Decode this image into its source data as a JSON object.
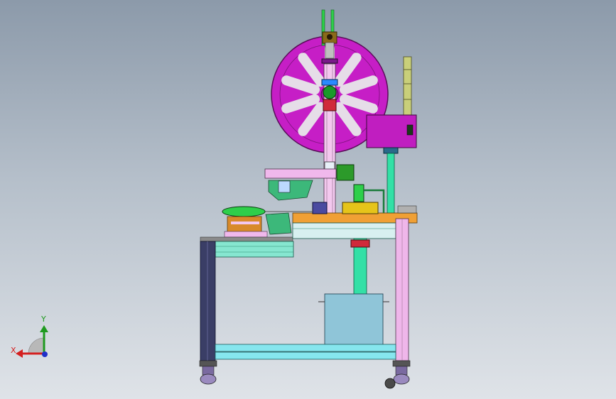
{
  "view": {
    "background_top": "#8c9aaa",
    "background_bottom": "#dfe3e8"
  },
  "triad": {
    "x_label": "X",
    "y_label": "Y",
    "x_color": "#d42020",
    "y_color": "#1f9a1f",
    "z_color": "#2030c8"
  },
  "colors": {
    "frame_magenta": "#c01ec0",
    "frame_pink": "#efb6ea",
    "frame_teal": "#7fe8d8",
    "frame_cyan": "#86e6ee",
    "frame_dark": "#3a3e66",
    "cabinet_blue": "#8fc5d8",
    "column_green": "#33e0a6",
    "plate_orange": "#f0a035",
    "column_lime": "#c9cf7a"
  }
}
